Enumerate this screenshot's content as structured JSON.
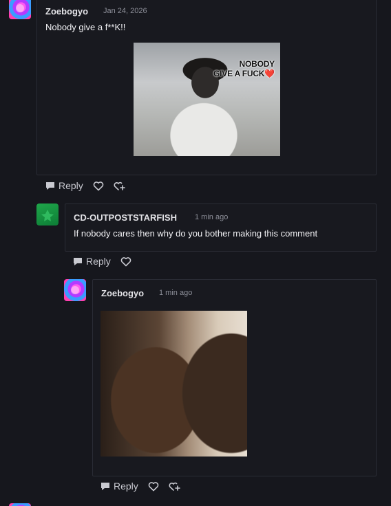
{
  "comments": [
    {
      "author": "Zoebogyo",
      "time": "Jan 24, 2026",
      "text": "Nobody give a f**K!!",
      "image_caption_line1": "NOBODY",
      "image_caption_line2": "GIVE A FUCK❤️",
      "reply_label": "Reply"
    },
    {
      "author": "CD-OUTPOSTSTARFISH",
      "time": "1 min ago",
      "text": "If nobody cares then why do you bother making this comment",
      "reply_label": "Reply"
    },
    {
      "author": "Zoebogyo",
      "time": "1 min ago",
      "reply_label": "Reply"
    }
  ],
  "colors": {
    "background": "#16171d",
    "card_border": "#2a2c35",
    "muted_text": "#8d8f99"
  },
  "icons": [
    "comment-bubble-icon",
    "heart-outline-icon",
    "add-reaction-icon"
  ]
}
